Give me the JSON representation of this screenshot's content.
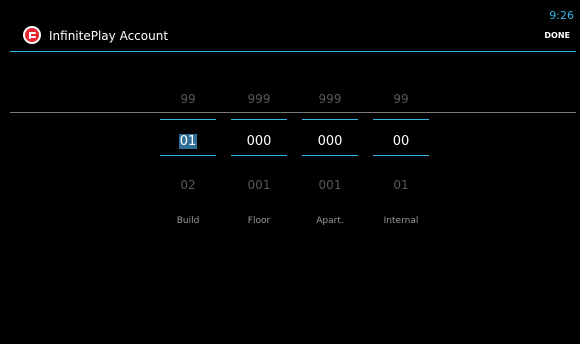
{
  "status_bar": {
    "time": "9:26"
  },
  "action_bar": {
    "title": "InfinitePlay Account",
    "done_label": "DONE"
  },
  "pickers": [
    {
      "label": "Build",
      "prev": "99",
      "current": "01",
      "next": "02",
      "selected": true
    },
    {
      "label": "Floor",
      "prev": "999",
      "current": "000",
      "next": "001",
      "selected": false
    },
    {
      "label": "Apart.",
      "prev": "999",
      "current": "000",
      "next": "001",
      "selected": false
    },
    {
      "label": "Internal",
      "prev": "99",
      "current": "00",
      "next": "01",
      "selected": false
    }
  ],
  "colors": {
    "accent": "#33b5e5",
    "background": "#000000",
    "logo": "#e3262f"
  }
}
